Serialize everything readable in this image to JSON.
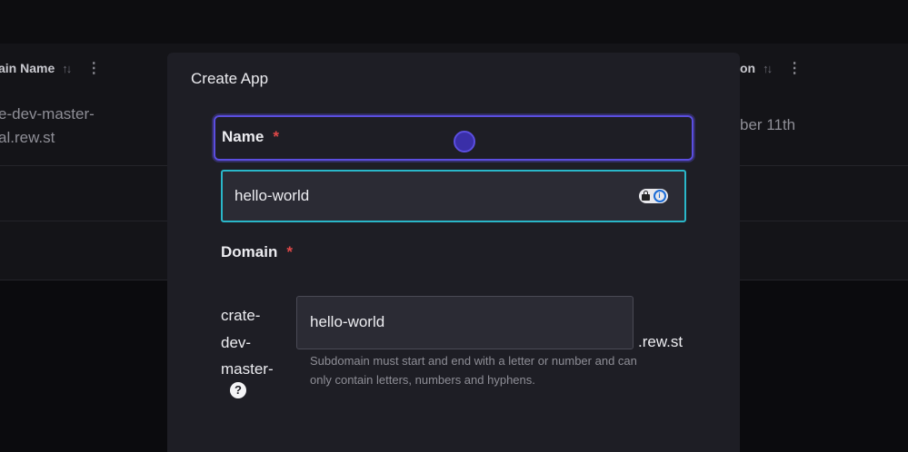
{
  "background_table": {
    "columns": [
      {
        "label": "ain Name"
      },
      {
        "label": "on"
      }
    ],
    "rows": [
      {
        "domain_line1": "e-dev-master-",
        "domain_line2": "al.rew.st",
        "date": "ber 11th"
      }
    ]
  },
  "modal": {
    "title": "Create App",
    "name_field": {
      "label": "Name",
      "required_mark": "*",
      "value": "hello-world"
    },
    "domain_field": {
      "label": "Domain",
      "required_mark": "*",
      "prefix_lines": [
        "crate-",
        "dev-",
        "master-"
      ],
      "help_icon": "?",
      "value": "hello-world",
      "suffix": ".rew.st",
      "hint": "Subdomain must start and end with a letter or number and can only contain letters, numbers and hyphens."
    }
  },
  "colors": {
    "focus_ring": "#5b4ee0",
    "input_focus_border": "#2ab7c9",
    "required": "#e04848",
    "modal_bg": "#1e1e25"
  },
  "icons": {
    "sort": "sort-icon",
    "kebab": "kebab-menu-icon",
    "password_manager": "password-manager-icon",
    "help": "help-icon"
  }
}
